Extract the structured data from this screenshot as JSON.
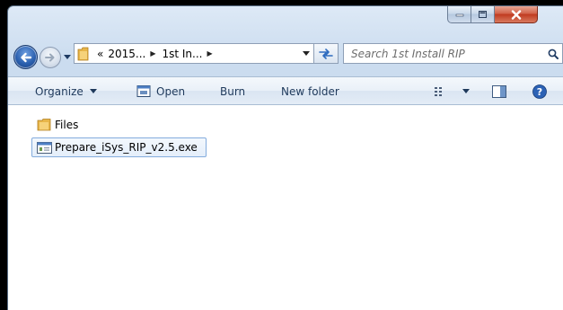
{
  "window": {
    "caption_buttons": {
      "minimize_icon": "minimize-icon",
      "maximize_icon": "maximize-icon",
      "close_icon": "close-icon"
    }
  },
  "nav": {
    "back_icon": "back-arrow-icon",
    "forward_icon": "forward-arrow-icon",
    "address": {
      "overflow": "«",
      "crumbs": [
        {
          "label": "2015..."
        },
        {
          "label": "1st In..."
        }
      ]
    },
    "search": {
      "placeholder": "Search 1st Install RIP"
    }
  },
  "toolbar": {
    "organize": "Organize",
    "open": "Open",
    "burn": "Burn",
    "new_folder": "New folder",
    "views_icon": "views-icon",
    "preview_pane_icon": "preview-pane-icon",
    "help_icon": "help-icon"
  },
  "files": [
    {
      "name": "Files",
      "type": "folder",
      "selected": false
    },
    {
      "name": "Prepare_iSys_RIP_v2.5.exe",
      "type": "application",
      "selected": true
    }
  ],
  "colors": {
    "frame": "#cbdcef",
    "command_text": "#1e395b",
    "selection_border": "#84acdd",
    "close_button": "#c03a1f",
    "folder": "#e8b64a"
  }
}
